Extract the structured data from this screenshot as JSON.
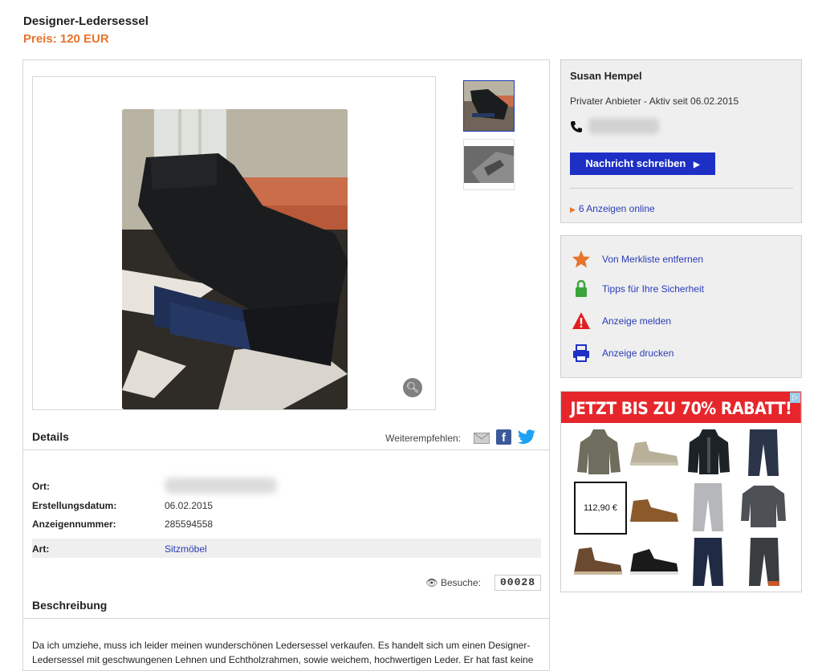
{
  "listing": {
    "title": "Designer-Ledersessel",
    "price": "Preis: 120 EUR"
  },
  "details": {
    "heading": "Details",
    "share_label": "Weiterempfehlen:",
    "rows": [
      {
        "key": "Ort:",
        "value": ""
      },
      {
        "key": "Erstellungsdatum:",
        "value": "06.02.2015"
      },
      {
        "key": "Anzeigennummer:",
        "value": "285594558"
      }
    ],
    "art": {
      "key": "Art:",
      "value": "Sitzmöbel"
    },
    "visits_label": "Besuche:",
    "visits_count": "00028"
  },
  "description": {
    "heading": "Beschreibung",
    "text": "Da ich umziehe, muss ich leider meinen wunderschönen Ledersessel verkaufen. Es handelt sich um einen Designer-Ledersessel mit geschwungenen Lehnen und Echtholzrahmen, sowie weichem, hochwertigen Leder. Er hat fast keine"
  },
  "seller": {
    "name": "Susan Hempel",
    "since": "Privater Anbieter - Aktiv seit 06.02.2015",
    "message_button": "Nachricht schreiben",
    "ads_link": "6 Anzeigen online"
  },
  "actions": [
    {
      "label": "Von Merkliste entfernen",
      "icon": "star-icon",
      "color": "#e8732b"
    },
    {
      "label": "Tipps für Ihre Sicherheit",
      "icon": "lock-icon",
      "color": "#3aa53a"
    },
    {
      "label": "Anzeige melden",
      "icon": "warning-icon",
      "color": "#e02020"
    },
    {
      "label": "Anzeige drucken",
      "icon": "printer-icon",
      "color": "#1e2fc6"
    }
  ],
  "ad_banner": {
    "headline": "JETZT BIS ZU 70% RABATT!",
    "price_tag": "112,90 €"
  },
  "colors": {
    "accent_orange": "#e8732b",
    "brand_blue": "#1e2fc6",
    "link_blue": "#2a3bb7"
  }
}
